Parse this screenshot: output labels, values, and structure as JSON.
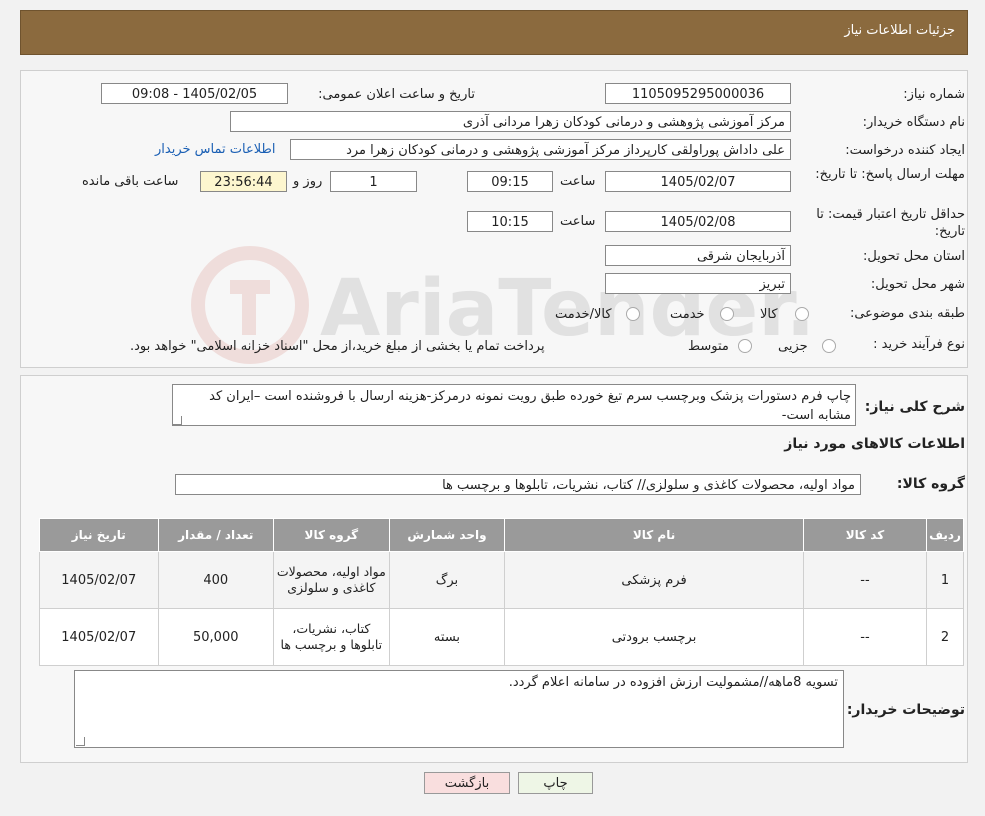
{
  "header": {
    "title": "جزئیات اطلاعات نیاز"
  },
  "form": {
    "need_number_label": "شماره نیاز:",
    "need_number": "1105095295000036",
    "announce_label": "تاریخ و ساعت اعلان عمومی:",
    "announce_value": "1405/02/05 - 09:08",
    "buyer_org_label": "نام دستگاه خریدار:",
    "buyer_org": "مرکز آموزشی پژوهشی و درمانی کودکان زهرا مردانی آذری",
    "creator_label": "ایجاد کننده درخواست:",
    "creator": "علی داداش پوراولقی کارپرداز مرکز آموزشی پژوهشی و درمانی کودکان زهرا مرد",
    "contact_link": "اطلاعات تماس خریدار",
    "deadline_label": "مهلت ارسال پاسخ: تا تاریخ:",
    "deadline_date": "1405/02/07",
    "time_label": "ساعت",
    "deadline_time": "09:15",
    "days_value": "1",
    "days_label": "روز و",
    "remaining_time": "23:56:44",
    "remaining_label": "ساعت باقی مانده",
    "validity_label": "حداقل تاریخ اعتبار قیمت: تا تاریخ:",
    "validity_date": "1405/02/08",
    "validity_time": "10:15",
    "province_label": "استان محل تحویل:",
    "province": "آذربایجان شرقی",
    "city_label": "شهر محل تحویل:",
    "city": "تبریز",
    "category_label": "طبقه بندی موضوعی:",
    "category_options": [
      "کالا",
      "خدمت",
      "کالا/خدمت"
    ],
    "process_label": "نوع فرآیند خرید :",
    "process_options": [
      "جزیی",
      "متوسط"
    ],
    "process_note": "پرداخت تمام یا بخشی از مبلغ خرید،از محل \"اسناد خزانه اسلامی\" خواهد بود."
  },
  "summary": {
    "label": "شرح کلی نیاز:",
    "text": "چاپ فرم دستورات پزشک وبرچسب سرم تیغ خورده طبق رویت نمونه درمرکز-هزینه ارسال با فروشنده است –ایران کد مشابه است-"
  },
  "goods": {
    "section_title": "اطلاعات کالاهای مورد نیاز",
    "group_label": "گروه کالا:",
    "group_value": "مواد اولیه، محصولات کاغذی و سلولزی// کتاب، نشریات، تابلوها و برچسب ها",
    "columns": [
      "ردیف",
      "کد کالا",
      "نام کالا",
      "واحد شمارش",
      "گروه کالا",
      "تعداد / مقدار",
      "تاریخ نیاز"
    ],
    "rows": [
      {
        "row": "1",
        "code": "--",
        "name": "فرم پزشکی",
        "unit": "برگ",
        "group": "مواد اولیه، محصولات کاغذی و سلولزی",
        "qty": "400",
        "date": "1405/02/07"
      },
      {
        "row": "2",
        "code": "--",
        "name": "برچسب برودتی",
        "unit": "بسته",
        "group": "کتاب، نشریات، تابلوها و برچسب ها",
        "qty": "50,000",
        "date": "1405/02/07"
      }
    ]
  },
  "buyer_notes": {
    "label": "توضیحات خریدار:",
    "text": "تسویه 8ماهه//مشمولیت ارزش افزوده در سامانه اعلام گردد."
  },
  "buttons": {
    "print": "چاپ",
    "back": "بازگشت"
  },
  "watermark": {
    "text": "AriaTender.neT"
  },
  "colors": {
    "header": "#8b6a3e",
    "link": "#1a5fb4",
    "back_button": "#f9dede",
    "print_button": "#eef6e6"
  }
}
